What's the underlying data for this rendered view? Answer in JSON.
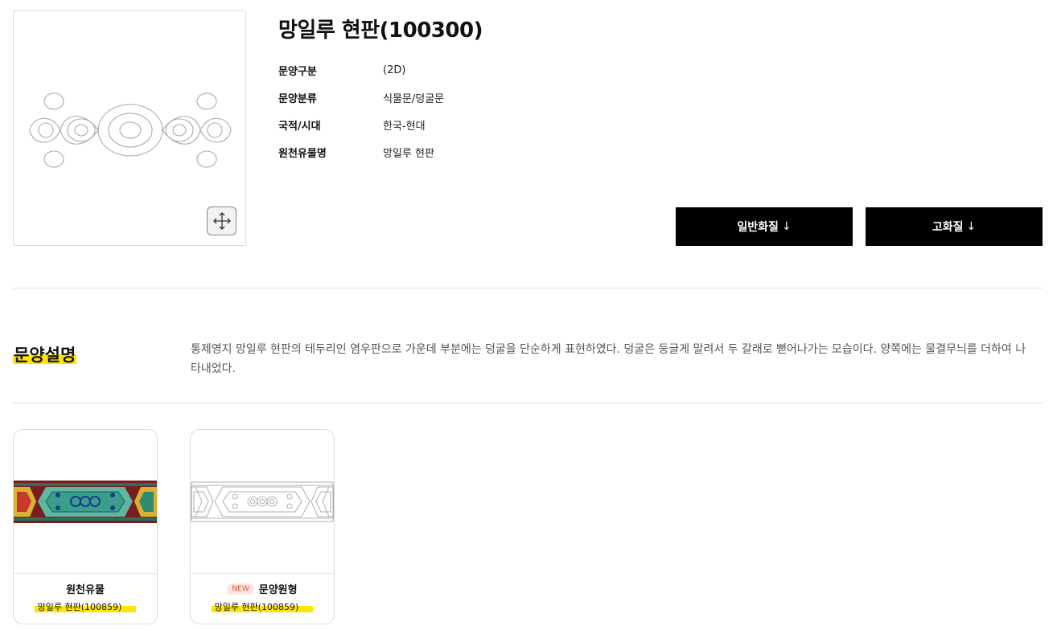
{
  "product": {
    "title": "망일루 현판(100300)",
    "meta": [
      {
        "key": "문양구분",
        "value": "(2D)"
      },
      {
        "key": "문양분류",
        "value": "식물문/덩굴문"
      },
      {
        "key": "국적/시대",
        "value": "한국-현대"
      },
      {
        "key": "원천유물명",
        "value": "망일루 현판"
      }
    ]
  },
  "downloads": {
    "normal_label": "일반화질",
    "high_label": "고화질",
    "arrow": "↓"
  },
  "description": {
    "heading": "문양설명",
    "text": "통제영지 망일루 현판의 테두리인 염우판으로 가운데 부분에는 덩굴을 단순하게 표현하였다. 덩굴은 둥글게 말려서 두 갈래로 뻗어나가는 모습이다. 양쪽에는 물결무늬를 더하여 나타내었다."
  },
  "related": [
    {
      "label": "원천유물",
      "sub": "망일루 현판(100859)",
      "badge": ""
    },
    {
      "label": "문양원형",
      "sub": "망일루 현판(100859)",
      "badge": "NEW"
    }
  ],
  "colors": {
    "highlight": "#ffe600",
    "button_bg": "#000000",
    "badge_bg": "#fde4e0",
    "badge_text": "#e0553a"
  }
}
